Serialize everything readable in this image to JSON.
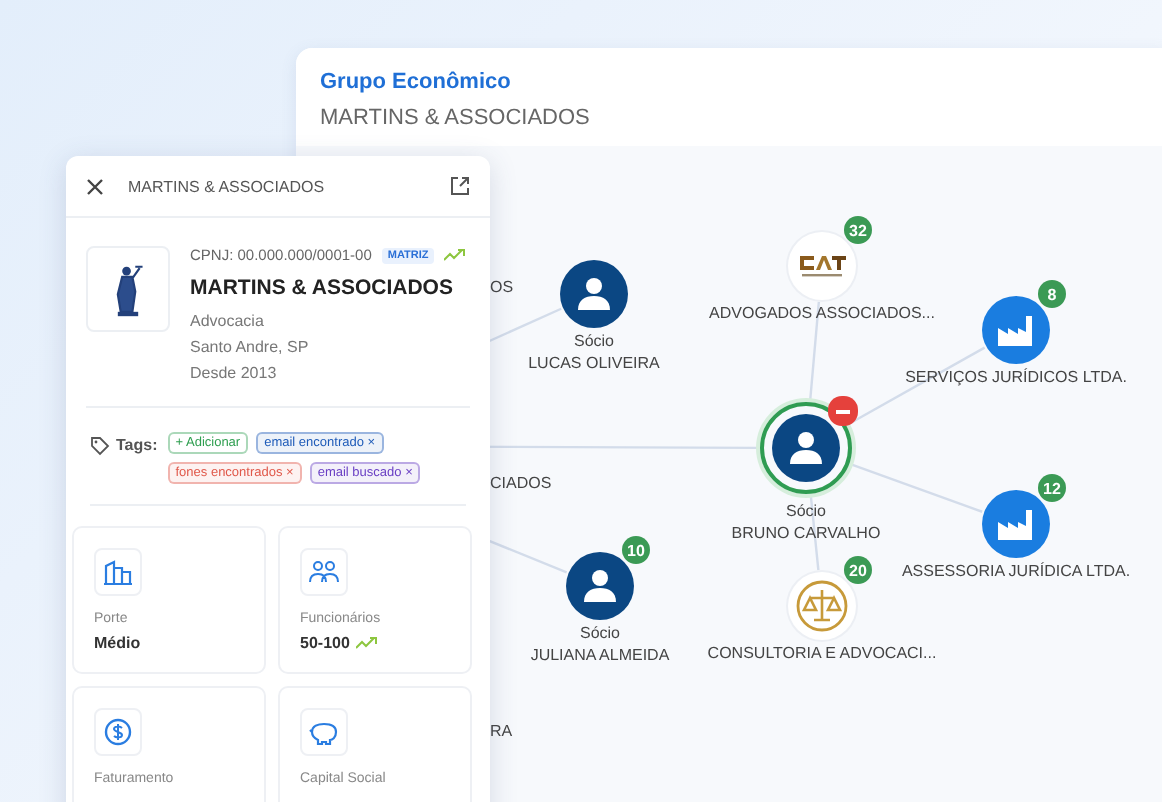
{
  "group_panel": {
    "title": "Grupo Econômico",
    "subtitle": "MARTINS & ASSOCIADOS"
  },
  "graph": {
    "hidden_labels": [
      "OS",
      "CIADOS",
      "RA"
    ],
    "nodes": [
      {
        "kind": "person",
        "role": "Sócio",
        "name": "LUCAS OLIVEIRA"
      },
      {
        "kind": "logo",
        "name": "ADVOGADOS ASSOCIADOS...",
        "badge": {
          "kind": "count",
          "text": "32"
        }
      },
      {
        "kind": "company",
        "name": "SERVIÇOS JURÍDICOS LTDA.",
        "badge": {
          "kind": "count",
          "text": "8"
        }
      },
      {
        "kind": "person",
        "role": "Sócio",
        "name": "BRUNO CARVALHO",
        "selected": true,
        "badge": {
          "kind": "remove"
        }
      },
      {
        "kind": "company",
        "name": "ASSESSORIA JURÍDICA LTDA.",
        "badge": {
          "kind": "count",
          "text": "12"
        }
      },
      {
        "kind": "person",
        "role": "Sócio",
        "name": "JULIANA ALMEIDA",
        "badge": {
          "kind": "count",
          "text": "10"
        }
      },
      {
        "kind": "seal",
        "name": "CONSULTORIA E ADVOCACI...",
        "badge": {
          "kind": "count",
          "text": "20"
        }
      }
    ]
  },
  "detail_panel": {
    "title": "MARTINS & ASSOCIADOS",
    "cnpj": "CPNJ: 00.000.000/0001-00",
    "badge": "MATRIZ",
    "trending_up": true,
    "name": "MARTINS & ASSOCIADOS",
    "info": [
      "Advocacia",
      "Santo Andre, SP",
      "Desde 2013"
    ],
    "tags_label": "Tags:",
    "tags": [
      {
        "kind": "add",
        "text": "+ Adicionar",
        "color": "#2e9e4f"
      },
      {
        "kind": "tag",
        "text": "email encontrado ×",
        "color": "#1e5bb8"
      },
      {
        "kind": "tag",
        "text": "fones encontrados ×",
        "color": "#e0584a"
      },
      {
        "kind": "tag",
        "text": "email buscado ×",
        "color": "#6a3fc4"
      }
    ],
    "stats": [
      {
        "label": "Porte",
        "value": "Médio",
        "trending_up": false
      },
      {
        "label": "Funcionários",
        "value": "50-100",
        "trending_up": true
      },
      {
        "label": "Faturamento"
      },
      {
        "label": "Capital Social"
      }
    ]
  }
}
